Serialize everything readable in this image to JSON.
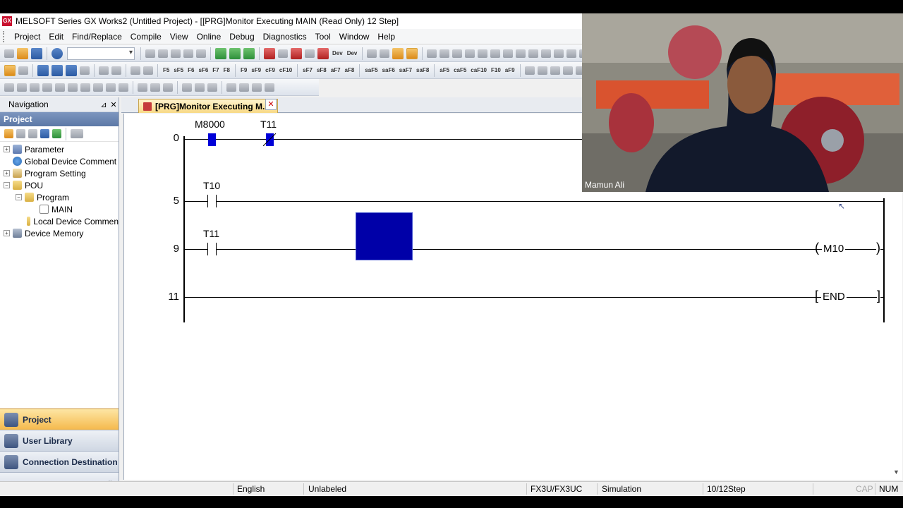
{
  "window": {
    "title": "MELSOFT Series GX Works2 (Untitled Project) - [[PRG]Monitor Executing MAIN (Read Only) 12 Step]",
    "app_icon_text": "GX"
  },
  "menu": [
    {
      "label": "Project"
    },
    {
      "label": "Edit"
    },
    {
      "label": "Find/Replace"
    },
    {
      "label": "Compile"
    },
    {
      "label": "View"
    },
    {
      "label": "Online"
    },
    {
      "label": "Debug"
    },
    {
      "label": "Diagnostics"
    },
    {
      "label": "Tool"
    },
    {
      "label": "Window"
    },
    {
      "label": "Help"
    }
  ],
  "toolbar_labels": {
    "dev1": "Dev",
    "dev2": "Dev",
    "f5": "F5",
    "sf5": "sF5",
    "f6": "F6",
    "sf6": "sF6",
    "f7": "F7",
    "f8": "F8",
    "f9": "F9",
    "sf9": "sF9",
    "cf9": "cF9",
    "cf10": "cF10",
    "sf7": "sF7",
    "sf8": "sF8",
    "af7": "aF7",
    "af8": "aF8",
    "saf5": "saF5",
    "saf6": "saF6",
    "saf7": "saF7",
    "saf8": "saF8",
    "af5": "aF5",
    "caf5": "caF5",
    "caf10": "caF10",
    "f10": "F10",
    "af9": "aF9"
  },
  "navigation": {
    "title": "Navigation",
    "pin_icon": "pin-icon",
    "close_icon": "close-icon",
    "section": "Project",
    "tree": [
      {
        "label": "Parameter",
        "expander": "+",
        "icon": "parameter-icon"
      },
      {
        "label": "Global Device Comment",
        "expander": "",
        "icon": "globe-icon"
      },
      {
        "label": "Program Setting",
        "expander": "+",
        "icon": "program-setting-icon"
      },
      {
        "label": "POU",
        "expander": "−",
        "icon": "folder-icon"
      },
      {
        "label": "Program",
        "expander": "−",
        "icon": "folder-icon"
      },
      {
        "label": "MAIN",
        "expander": "",
        "icon": "program-icon"
      },
      {
        "label": "Local Device Commen",
        "expander": "",
        "icon": "folder-icon"
      },
      {
        "label": "Device Memory",
        "expander": "+",
        "icon": "memory-icon"
      }
    ],
    "buttons": [
      {
        "label": "Project",
        "active": true
      },
      {
        "label": "User Library",
        "active": false
      },
      {
        "label": "Connection Destination",
        "active": false
      }
    ],
    "more_glyph": "»"
  },
  "editor": {
    "tab_label": "[PRG]Monitor Executing M...",
    "tab_close": "✕",
    "rungs": [
      {
        "step": "0",
        "contacts": [
          {
            "device": "M8000",
            "state": "on"
          },
          {
            "device": "T11",
            "state": "on-nc"
          }
        ]
      },
      {
        "step": "5",
        "contacts": [
          {
            "device": "T10",
            "state": "off"
          }
        ]
      },
      {
        "step": "9",
        "contacts": [
          {
            "device": "T11",
            "state": "off"
          }
        ],
        "coil": "M10"
      },
      {
        "step": "11",
        "instruction": "END"
      }
    ],
    "coil_open": "(",
    "coil_close": ")",
    "end_open": "[",
    "end_close": "]"
  },
  "statusbar": {
    "language": "English",
    "label": "Unlabeled",
    "plc": "FX3U/FX3UC",
    "connection": "Simulation",
    "steps": "10/12Step",
    "cap": "CAP",
    "num": "NUM"
  },
  "webcam": {
    "name": "Mamun Ali"
  },
  "colors": {
    "monitor_on": "#0000d8",
    "cursor": "#0000a8",
    "active_nav": "#f5b94c"
  }
}
